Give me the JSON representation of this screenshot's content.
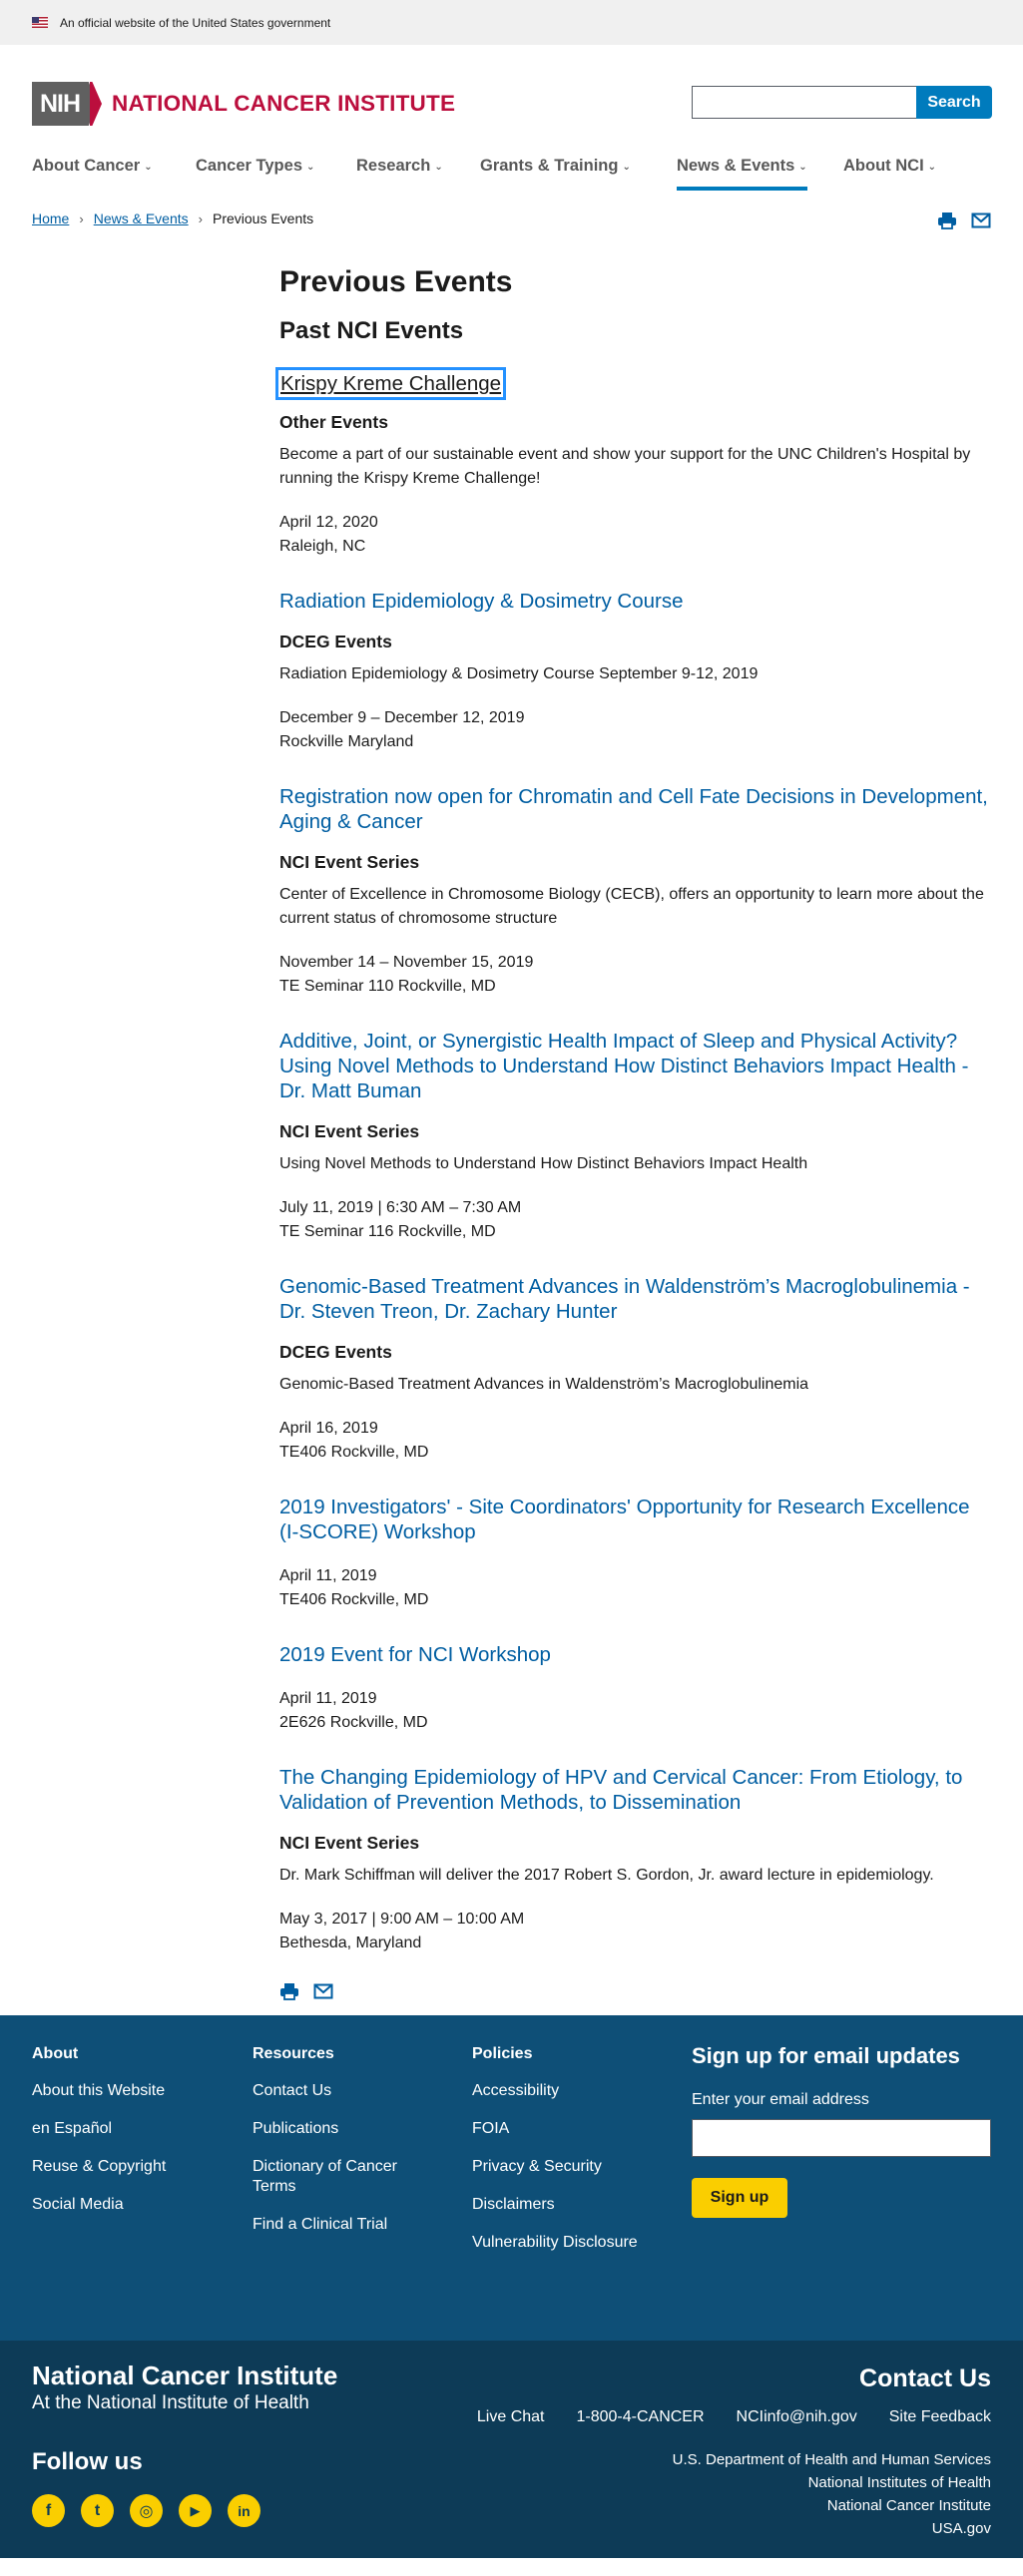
{
  "gov_banner": {
    "text": "An official website of the United States government"
  },
  "header": {
    "logo_badge": "NIH",
    "logo_text": "NATIONAL CANCER INSTITUTE",
    "search_placeholder": "",
    "search_button": "Search"
  },
  "nav": {
    "items": [
      {
        "label": "About Cancer"
      },
      {
        "label": "Cancer Types"
      },
      {
        "label": "Research"
      },
      {
        "label": "Grants & Training"
      },
      {
        "label": "News & Events",
        "active": true
      },
      {
        "label": "About NCI"
      }
    ]
  },
  "breadcrumb": {
    "home": "Home",
    "section": "News & Events",
    "current": "Previous Events"
  },
  "main": {
    "title": "Previous Events",
    "subtitle": "Past NCI Events",
    "events": [
      {
        "title": "Krispy Kreme Challenge",
        "category": "Other Events",
        "description": "Become a part of our sustainable event and show your support for the UNC Children's Hospital by running the Krispy Kreme Challenge!",
        "date": "April 12, 2020",
        "location": "Raleigh, NC"
      },
      {
        "title": "Radiation Epidemiology & Dosimetry Course",
        "category": "DCEG Events",
        "description": "Radiation Epidemiology & Dosimetry Course September 9-12, 2019",
        "date": "December 9 – December 12, 2019",
        "location": "Rockville Maryland"
      },
      {
        "title": "Registration now open for Chromatin and Cell Fate Decisions in Development, Aging & Cancer",
        "category": "NCI Event Series",
        "description": "Center of Excellence in Chromosome Biology (CECB), offers an opportunity to learn more about the current status of chromosome structure",
        "date": "November 14 – November 15, 2019",
        "location": "TE Seminar 110 Rockville, MD"
      },
      {
        "title": "Additive, Joint, or Synergistic Health Impact of Sleep and Physical Activity? Using Novel Methods to Understand How Distinct Behaviors Impact Health - Dr. Matt Buman",
        "category": "NCI Event Series",
        "description": "Using Novel Methods to Understand How Distinct Behaviors Impact Health",
        "date": "July 11, 2019 | 6:30 AM – 7:30 AM",
        "location": "TE Seminar 116 Rockville, MD"
      },
      {
        "title": "Genomic-Based Treatment Advances in Waldenström’s Macroglobulinemia - Dr. Steven Treon, Dr. Zachary Hunter",
        "category": "DCEG Events",
        "description": "Genomic-Based Treatment Advances in Waldenström’s Macroglobulinemia",
        "date": "April 16, 2019",
        "location": "TE406 Rockville, MD"
      },
      {
        "title": "2019 Investigators' - Site Coordinators' Opportunity for Research Excellence (I-SCORE) Workshop",
        "category": "",
        "description": "",
        "date": "April 11, 2019",
        "location": "TE406 Rockville, MD"
      },
      {
        "title": "2019 Event for NCI Workshop",
        "category": "",
        "description": "",
        "date": "April 11, 2019",
        "location": "2E626 Rockville, MD"
      },
      {
        "title": "The Changing Epidemiology of HPV and Cervical Cancer: From Etiology, to Validation of Prevention Methods, to Dissemination",
        "category": "NCI Event Series",
        "description": "Dr. Mark Schiffman will deliver the 2017 Robert S. Gordon, Jr. award lecture in epidemiology.",
        "date": "May 3, 2017 | 9:00 AM – 10:00 AM",
        "location": "Bethesda, Maryland"
      }
    ]
  },
  "footer": {
    "about": {
      "heading": "About",
      "links": [
        "About this Website",
        "en Español",
        "Reuse & Copyright",
        "Social Media"
      ]
    },
    "resources": {
      "heading": "Resources",
      "links": [
        "Contact Us",
        "Publications",
        "Dictionary of Cancer Terms",
        "Find a Clinical Trial"
      ]
    },
    "policies": {
      "heading": "Policies",
      "links": [
        "Accessibility",
        "FOIA",
        "Privacy & Security",
        "Disclaimers",
        "Vulnerability Disclosure"
      ]
    },
    "signup": {
      "heading": "Sign up for email updates",
      "label": "Enter your email address",
      "button": "Sign up"
    },
    "org_name": "National Cancer Institute",
    "org_sub": "At the National Institute of Health",
    "contact_heading": "Contact Us",
    "contact_links": [
      "Live Chat",
      "1-800-4-CANCER",
      "NCIinfo@nih.gov",
      "Site Feedback"
    ],
    "follow_heading": "Follow us",
    "social": [
      {
        "icon": "facebook-icon",
        "glyph": "f"
      },
      {
        "icon": "twitter-icon",
        "glyph": "t"
      },
      {
        "icon": "instagram-icon",
        "glyph": "◎"
      },
      {
        "icon": "youtube-icon",
        "glyph": "▶"
      },
      {
        "icon": "linkedin-icon",
        "glyph": "in"
      }
    ],
    "agencies": [
      "U.S. Department of Health and Human Services",
      "National Institutes of Health",
      "National Cancer Institute",
      "USA.gov"
    ]
  },
  "colors": {
    "brand_red": "#bb0e3d",
    "link_blue": "#005ea2",
    "accent_blue": "#007bbd",
    "footer_top": "#0e4f77",
    "footer_bottom": "#0d3b57",
    "signup_yellow": "#face00"
  }
}
